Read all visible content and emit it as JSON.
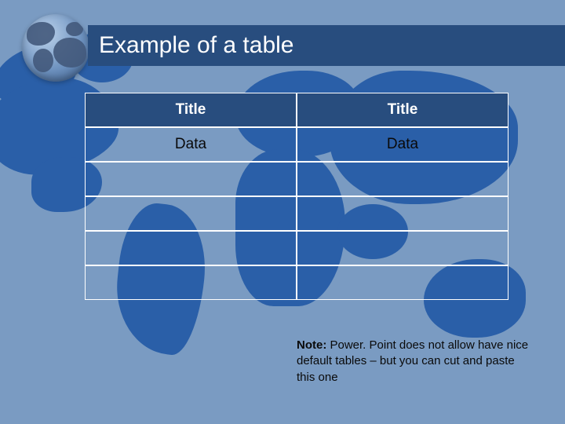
{
  "title": "Example of a table",
  "table": {
    "headers": [
      "Title",
      "Title"
    ],
    "rows": [
      [
        "Data",
        "Data"
      ],
      [
        "",
        ""
      ],
      [
        "",
        ""
      ],
      [
        "",
        ""
      ],
      [
        "",
        ""
      ]
    ]
  },
  "note": {
    "label": "Note:",
    "text": " Power. Point does not allow have nice default tables – but you can cut and paste this one"
  }
}
